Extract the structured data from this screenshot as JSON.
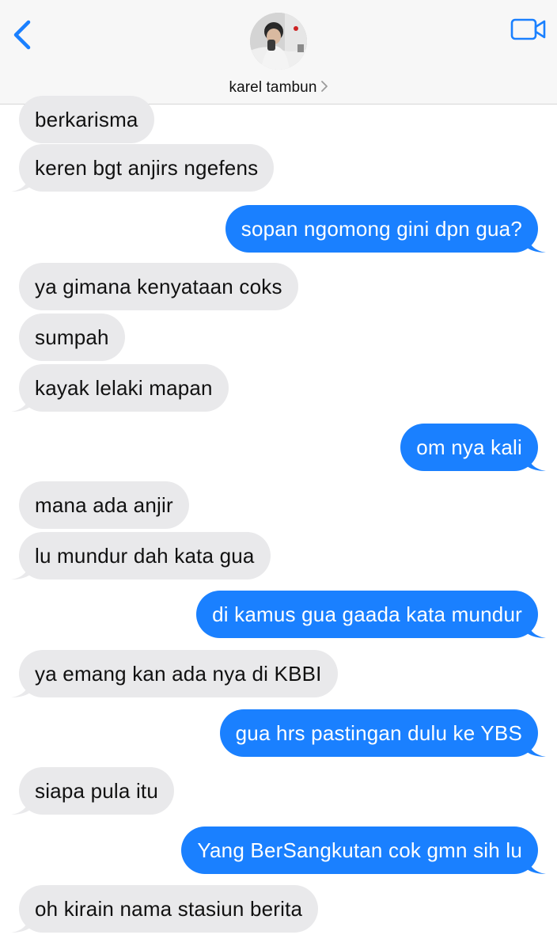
{
  "header": {
    "contact_name": "karel tambun",
    "back_icon": "chevron-left-icon",
    "video_icon": "video-camera-icon",
    "accent_color": "#1a80ff"
  },
  "messages": [
    {
      "from": "them",
      "text": "berkarisma"
    },
    {
      "from": "them",
      "text": "keren bgt anjirs ngefens"
    },
    {
      "from": "me",
      "text": "sopan ngomong gini dpn gua?"
    },
    {
      "from": "them",
      "text": "ya gimana kenyataan coks"
    },
    {
      "from": "them",
      "text": "sumpah"
    },
    {
      "from": "them",
      "text": "kayak lelaki mapan"
    },
    {
      "from": "me",
      "text": "om nya kali"
    },
    {
      "from": "them",
      "text": "mana ada anjir"
    },
    {
      "from": "them",
      "text": "lu mundur dah kata gua"
    },
    {
      "from": "me",
      "text": "di kamus gua gaada kata mundur"
    },
    {
      "from": "them",
      "text": "ya emang kan ada nya di KBBI"
    },
    {
      "from": "me",
      "text": "gua hrs pastingan dulu ke YBS"
    },
    {
      "from": "them",
      "text": "siapa pula itu"
    },
    {
      "from": "me",
      "text": "Yang BerSangkutan cok gmn sih lu"
    },
    {
      "from": "them",
      "text": "oh kirain nama stasiun berita"
    }
  ]
}
